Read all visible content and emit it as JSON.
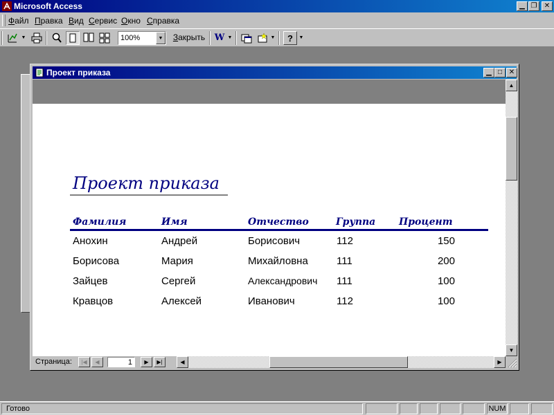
{
  "app": {
    "title": "Microsoft Access"
  },
  "menu": {
    "items": [
      "Файл",
      "Правка",
      "Вид",
      "Сервис",
      "Окно",
      "Справка"
    ]
  },
  "toolbar": {
    "zoom": "100%",
    "close_label": "Закрыть"
  },
  "report_window": {
    "title": "Проект приказа"
  },
  "report": {
    "heading": "Проект приказа",
    "columns": [
      "Фамилия",
      "Имя",
      "Отчество",
      "Группа",
      "Процент"
    ],
    "rows": [
      [
        "Анохин",
        "Андрей",
        "Борисович",
        "112",
        "150"
      ],
      [
        "Борисова",
        "Мария",
        "Михайловна",
        "111",
        "200"
      ],
      [
        "Зайцев",
        "Сергей",
        "Александрович",
        "111",
        "100"
      ],
      [
        "Кравцов",
        "Алексей",
        "Иванович",
        "112",
        "100"
      ]
    ]
  },
  "navigation": {
    "label": "Страница:",
    "page": "1"
  },
  "status": {
    "text": "Готово",
    "num": "NUM"
  }
}
